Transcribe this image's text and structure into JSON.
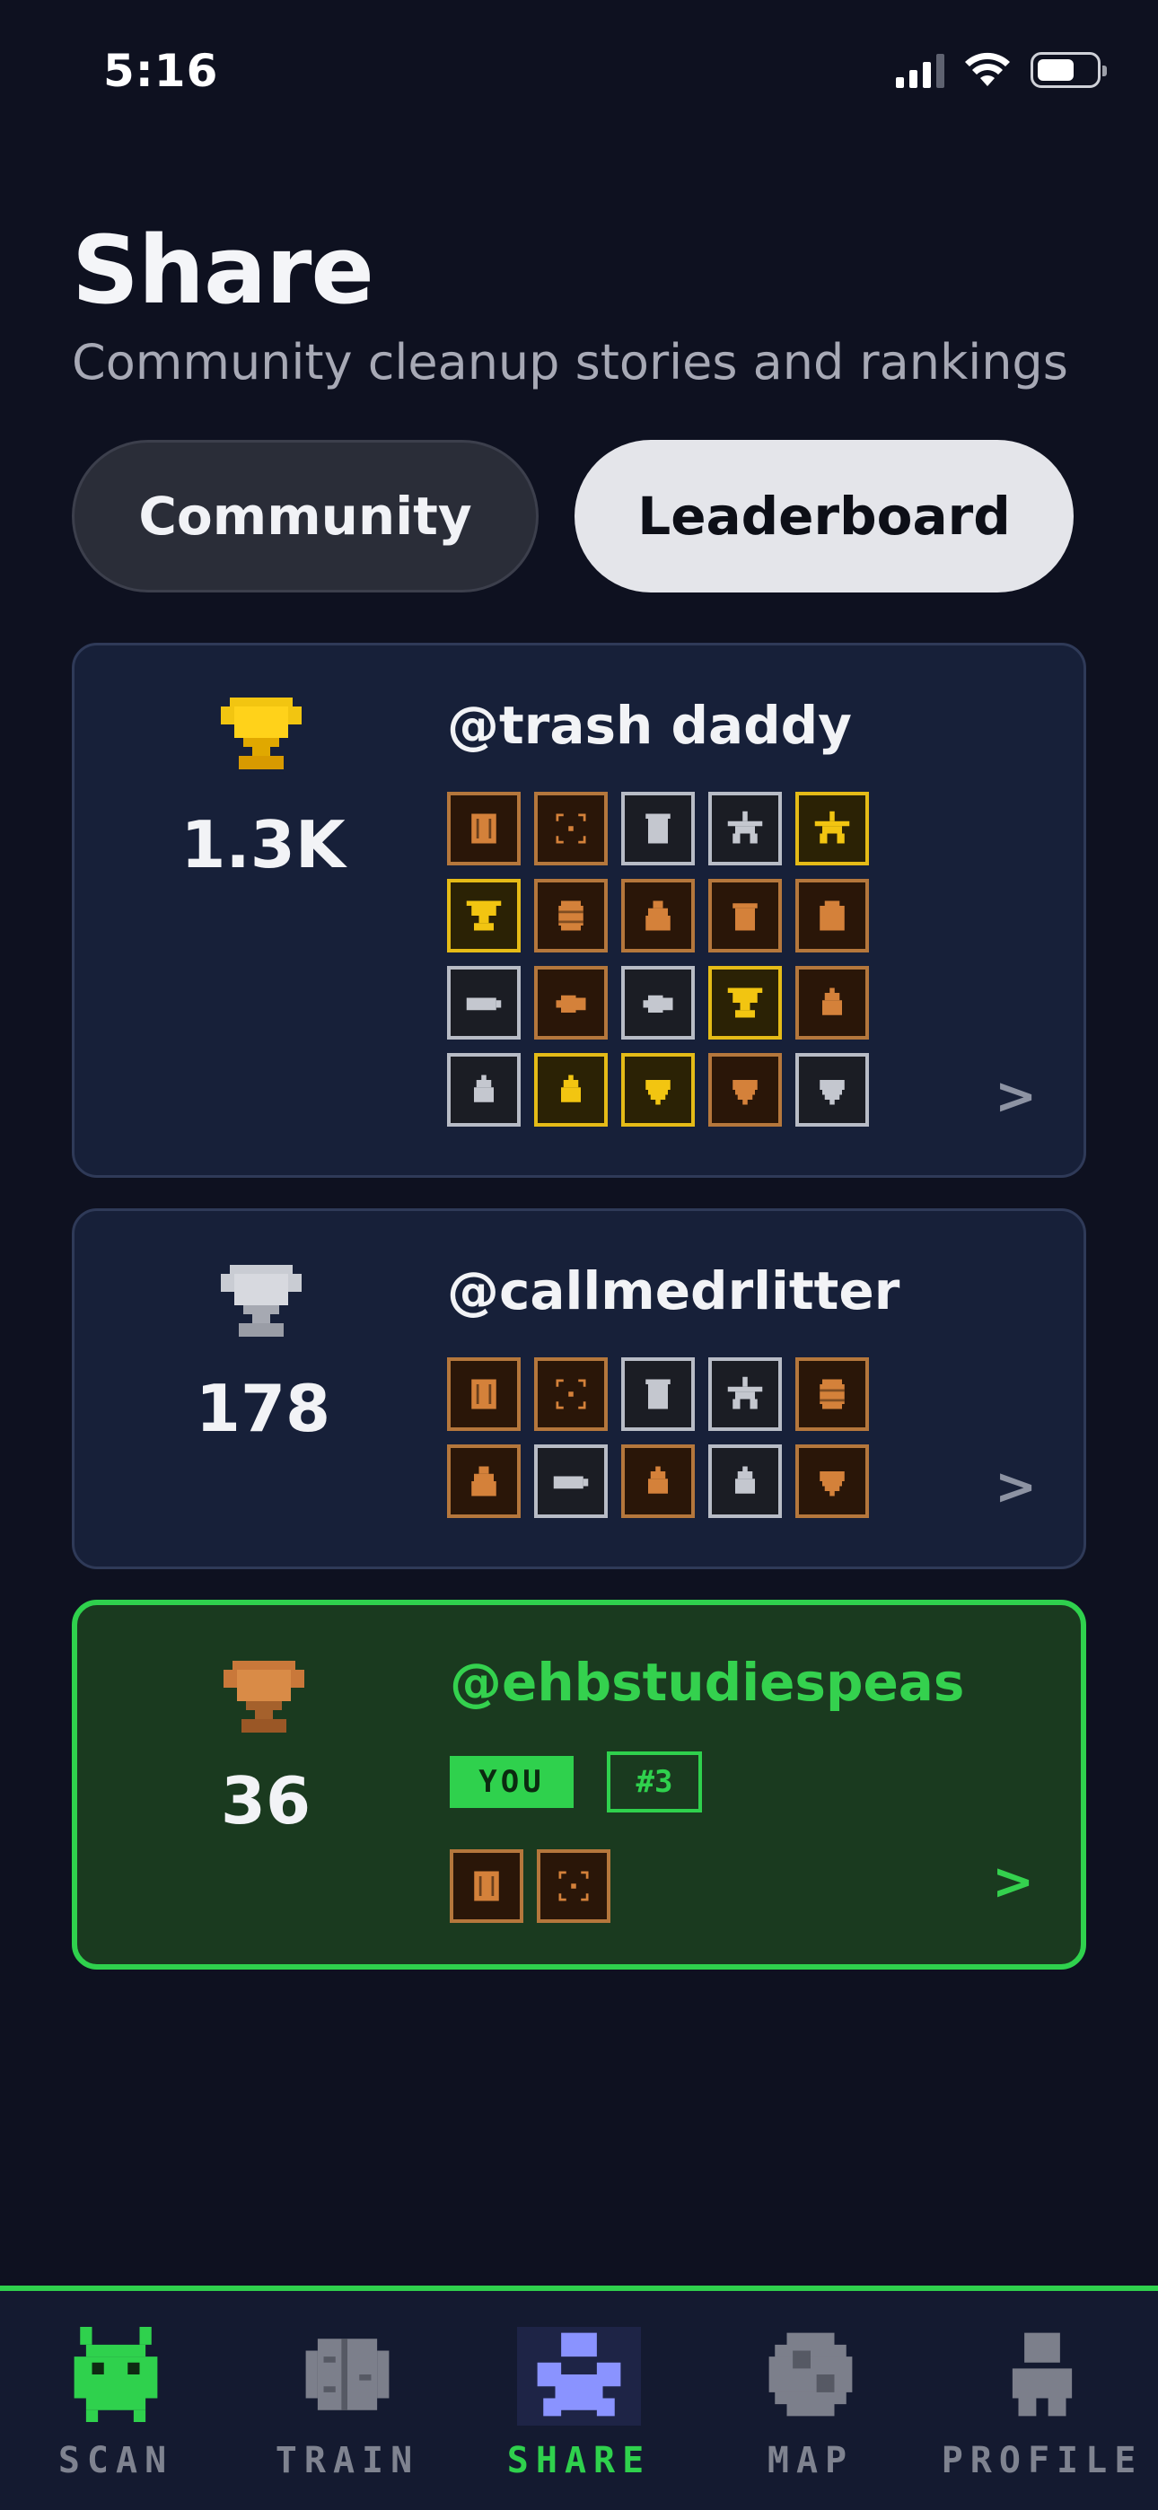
{
  "status_bar": {
    "time": "5:16"
  },
  "header": {
    "title": "Share",
    "subtitle": "Community cleanup stories and rankings"
  },
  "tabs": [
    {
      "label": "Community",
      "active": false
    },
    {
      "label": "Leaderboard",
      "active": true
    }
  ],
  "leaderboard": [
    {
      "username": "@trash daddy",
      "score": "1.3K",
      "trophy": "gold-trophy-icon",
      "badges": [
        {
          "tier": "bronze",
          "icon": "bin-icon"
        },
        {
          "tier": "bronze",
          "icon": "scan-frame-icon"
        },
        {
          "tier": "silver",
          "icon": "trash-can-icon"
        },
        {
          "tier": "silver",
          "icon": "star-icon"
        },
        {
          "tier": "gold",
          "icon": "star-icon"
        },
        {
          "tier": "gold",
          "icon": "trophy-icon"
        },
        {
          "tier": "bronze",
          "icon": "barrel-icon"
        },
        {
          "tier": "bronze",
          "icon": "bag-icon"
        },
        {
          "tier": "bronze",
          "icon": "cup-icon"
        },
        {
          "tier": "bronze",
          "icon": "jar-icon"
        },
        {
          "tier": "silver",
          "icon": "battery-icon"
        },
        {
          "tier": "bronze",
          "icon": "bottle-icon"
        },
        {
          "tier": "silver",
          "icon": "bottle-icon"
        },
        {
          "tier": "gold",
          "icon": "trophy-icon"
        },
        {
          "tier": "bronze",
          "icon": "flame-icon"
        },
        {
          "tier": "silver",
          "icon": "flame-icon"
        },
        {
          "tier": "gold",
          "icon": "flame-icon"
        },
        {
          "tier": "gold",
          "icon": "heart-icon"
        },
        {
          "tier": "bronze",
          "icon": "heart-icon"
        },
        {
          "tier": "silver",
          "icon": "heart-icon"
        }
      ]
    },
    {
      "username": "@callmedrlitter",
      "score": "178",
      "trophy": "silver-trophy-icon",
      "badges": [
        {
          "tier": "bronze",
          "icon": "bin-icon"
        },
        {
          "tier": "bronze",
          "icon": "scan-frame-icon"
        },
        {
          "tier": "silver",
          "icon": "trash-can-icon"
        },
        {
          "tier": "silver",
          "icon": "star-icon"
        },
        {
          "tier": "bronze",
          "icon": "barrel-icon"
        },
        {
          "tier": "bronze",
          "icon": "bag-icon"
        },
        {
          "tier": "silver",
          "icon": "battery-icon"
        },
        {
          "tier": "bronze",
          "icon": "flame-icon"
        },
        {
          "tier": "silver",
          "icon": "flame-icon"
        },
        {
          "tier": "bronze",
          "icon": "heart-icon"
        }
      ]
    },
    {
      "username": "@ehbstudiespeas",
      "score": "36",
      "trophy": "bronze-trophy-icon",
      "you_label": "YOU",
      "rank_label": "#3",
      "badges": [
        {
          "tier": "bronze",
          "icon": "bin-icon"
        },
        {
          "tier": "bronze",
          "icon": "scan-frame-icon"
        }
      ]
    }
  ],
  "chevron": ">",
  "bottom_nav": [
    {
      "label": "SCAN",
      "icon": "alien-icon",
      "active": false
    },
    {
      "label": "TRAIN",
      "icon": "brain-icon",
      "active": false
    },
    {
      "label": "SHARE",
      "icon": "paw-icon",
      "active": true
    },
    {
      "label": "MAP",
      "icon": "globe-icon",
      "active": false
    },
    {
      "label": "PROFILE",
      "icon": "person-icon",
      "active": false
    }
  ],
  "colors": {
    "background": "#0e1120",
    "card": "#172039",
    "accent_green": "#2fd14d",
    "gold": "#e5bb17",
    "silver": "#b8bcc6",
    "bronze": "#b5773c"
  }
}
